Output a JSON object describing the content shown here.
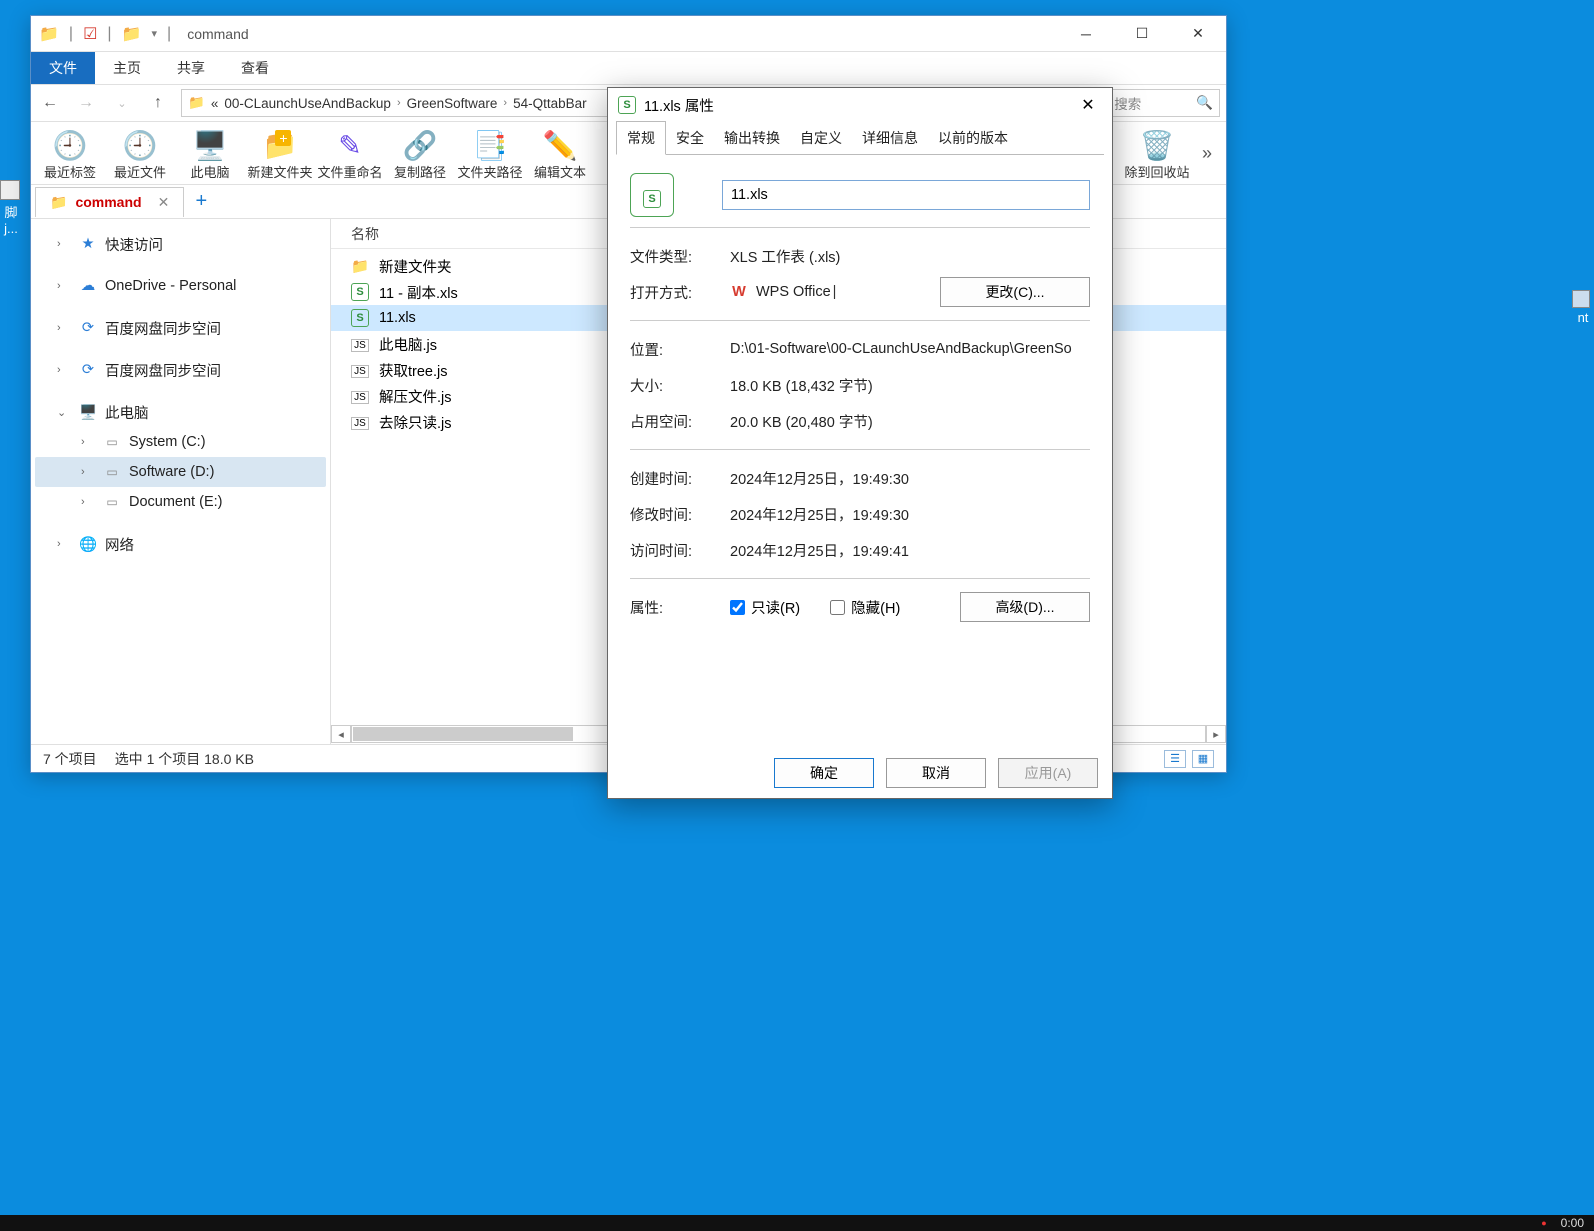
{
  "desktop": {
    "icon_label_fragment_1": "脚",
    "icon_label_fragment_2": "j...",
    "right_fragment": "nt"
  },
  "explorer": {
    "title": "command",
    "ribbon": {
      "file": "文件",
      "home": "主页",
      "share": "共享",
      "view": "查看"
    },
    "breadcrumbs": {
      "prefix": "«",
      "seg1": "00-CLaunchUseAndBackup",
      "seg2": "GreenSoftware",
      "seg3": "54-QttabBar"
    },
    "search_placeholder_fragment": "nand 中搜索",
    "toolbar": {
      "recent_tab": "最近标签",
      "recent_file": "最近文件",
      "this_pc": "此电脑",
      "new_folder": "新建文件夹",
      "rename": "文件重命名",
      "copy_path": "复制路径",
      "folder_path": "文件夹路径",
      "edit_text": "编辑文本",
      "recycle": "除到回收站"
    },
    "tab_name": "command",
    "nav": {
      "quick": "快速访问",
      "onedrive": "OneDrive - Personal",
      "baidu1": "百度网盘同步空间",
      "baidu2": "百度网盘同步空间",
      "this_pc": "此电脑",
      "sysc": "System (C:)",
      "softd": "Software (D:)",
      "doce": "Document (E:)",
      "network": "网络"
    },
    "list": {
      "header_name": "名称",
      "items": [
        {
          "icon": "folder",
          "name": "新建文件夹"
        },
        {
          "icon": "xls",
          "name": "11 - 副本.xls"
        },
        {
          "icon": "xls",
          "name": "11.xls",
          "sel": true
        },
        {
          "icon": "js",
          "name": "此电脑.js"
        },
        {
          "icon": "js",
          "name": "获取tree.js"
        },
        {
          "icon": "js",
          "name": "解压文件.js"
        },
        {
          "icon": "js",
          "name": "去除只读.js"
        }
      ]
    },
    "status": {
      "count": "7 个项目",
      "selected": "选中 1 个项目  18.0 KB"
    }
  },
  "props": {
    "title": "11.xls 属性",
    "tabs": [
      "常规",
      "安全",
      "输出转换",
      "自定义",
      "详细信息",
      "以前的版本"
    ],
    "filename": "11.xls",
    "labels": {
      "file_type": "文件类型:",
      "opens_with": "打开方式:",
      "location": "位置:",
      "size": "大小:",
      "disk": "占用空间:",
      "created": "创建时间:",
      "modified": "修改时间:",
      "accessed": "访问时间:",
      "attrs": "属性:"
    },
    "values": {
      "file_type": "XLS 工作表 (.xls)",
      "opens_with": "WPS Office",
      "change_btn": "更改(C)...",
      "location": "D:\\01-Software\\00-CLaunchUseAndBackup\\GreenSo",
      "size": "18.0 KB (18,432 字节)",
      "disk": "20.0 KB (20,480 字节)",
      "created": "2024年12月25日，19:49:30",
      "modified": "2024年12月25日，19:49:30",
      "accessed": "2024年12月25日，19:49:41",
      "readonly": "只读(R)",
      "hidden": "隐藏(H)",
      "advanced": "高级(D)..."
    },
    "buttons": {
      "ok": "确定",
      "cancel": "取消",
      "apply": "应用(A)"
    }
  },
  "taskbar": {
    "indicator": "●",
    "clock": "0:00"
  }
}
